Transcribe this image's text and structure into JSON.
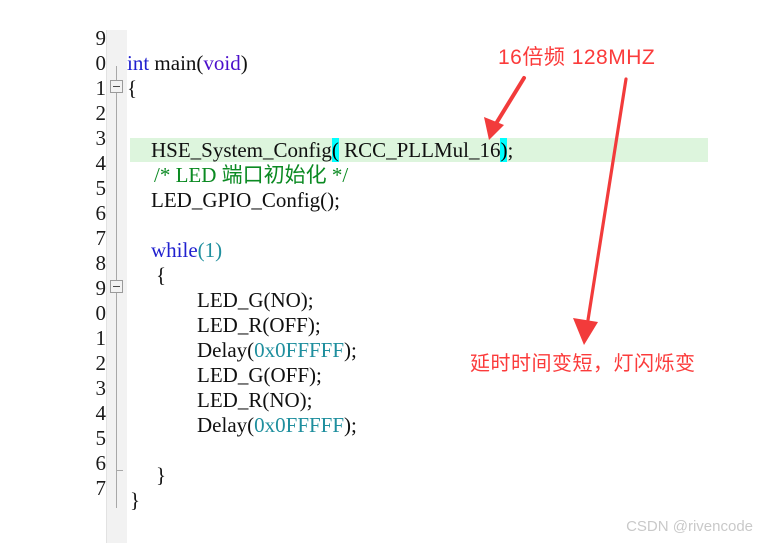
{
  "editor": {
    "line_numbers": [
      "9",
      "0",
      "1",
      "2",
      "3",
      "4",
      "5",
      "6",
      "7",
      "8",
      "9",
      "0",
      "1",
      "2",
      "3",
      "4",
      "5",
      "6",
      "7"
    ],
    "lines": [
      {
        "n": 0,
        "text": ""
      },
      {
        "n": 1,
        "text": "int main(void)"
      },
      {
        "n": 2,
        "text": "{"
      },
      {
        "n": 3,
        "text": ""
      },
      {
        "n": 4,
        "text": "    HSE_System_Config( RCC_PLLMul_16);"
      },
      {
        "n": 5,
        "text": "    /* LED 端口初始化 */"
      },
      {
        "n": 6,
        "text": "    LED_GPIO_Config();"
      },
      {
        "n": 7,
        "text": ""
      },
      {
        "n": 8,
        "text": "    while(1)"
      },
      {
        "n": 9,
        "text": "    {"
      },
      {
        "n": 10,
        "text": "        LED_G(NO);"
      },
      {
        "n": 11,
        "text": "        LED_R(OFF);"
      },
      {
        "n": 12,
        "text": "        Delay(0x0FFFFF);"
      },
      {
        "n": 13,
        "text": "        LED_G(OFF);"
      },
      {
        "n": 14,
        "text": "        LED_R(NO);"
      },
      {
        "n": 15,
        "text": "        Delay(0x0FFFFF);"
      },
      {
        "n": 16,
        "text": ""
      },
      {
        "n": 17,
        "text": "    }"
      },
      {
        "n": 18,
        "text": "}"
      }
    ],
    "tokens": {
      "kw_int": "int",
      "fn_main": " main",
      "paren_open": "(",
      "kw_void": "void",
      "paren_close": ")",
      "brace_open": "{",
      "brace_close": "}",
      "call_hse": "HSE_System_Config",
      "brk_open": "(",
      "arg_pllmul": " RCC_PLLMul_16",
      "brk_close": ")",
      "semi": ";",
      "comment_led": "/* LED 端口初始化 */",
      "call_ledgpio": "LED_GPIO_Config();",
      "kw_while": "while",
      "while_cond_open": "(",
      "while_cond_num": "1",
      "while_cond_close": ")",
      "call_ledg_no": "LED_G(NO);",
      "call_ledr_off": "LED_R(OFF);",
      "call_delay_pre": "Delay(",
      "hex_value": "0x0FFFFF",
      "call_delay_post": ");",
      "call_ledg_off": "LED_G(OFF);",
      "call_ledr_no": "LED_R(NO);"
    },
    "colors": {
      "keyword": "#2020cf",
      "type_keyword": "#4b0ecb",
      "number": "#1f8f9e",
      "comment": "#0b8a22",
      "bracket_match_bg": "#00ffff",
      "highlight_row_bg": "#ddf5dd",
      "code_text": "#101010",
      "gutter_bg": "#f2f2f2",
      "background": "#ffffff"
    }
  },
  "annotations": {
    "top_note": "16倍频  128MHZ",
    "delay_note": "延时时间变短，灯闪烁变",
    "color": "#fb3b3b",
    "arrow_to_pllmul": "arrow-down-left",
    "arrow_to_delay": "arrow-down-long"
  },
  "watermark": {
    "text": "CSDN @rivencode",
    "color": "#c9c9c9"
  }
}
